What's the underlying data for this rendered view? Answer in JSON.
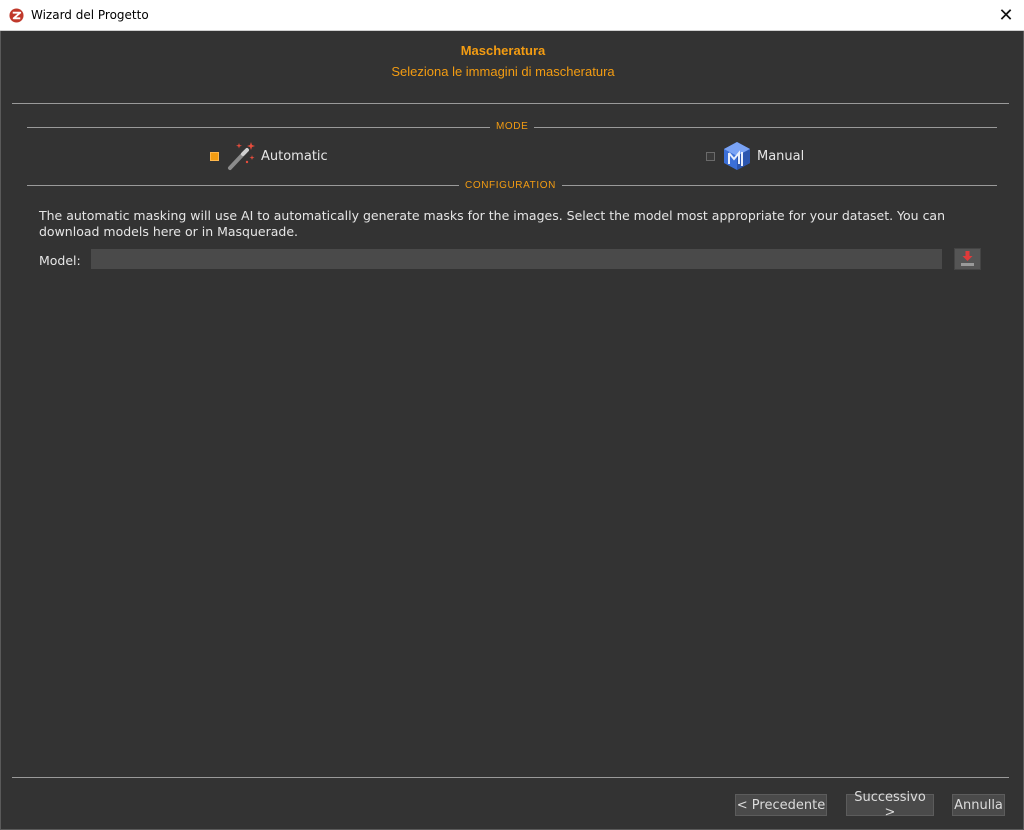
{
  "window": {
    "title": "Wizard del Progetto",
    "close_symbol": "✕"
  },
  "header": {
    "title": "Mascheratura",
    "subtitle": "Seleziona le immagini di mascheratura"
  },
  "mode": {
    "group_label": "MODE",
    "options": [
      {
        "label": "Automatic",
        "selected": true,
        "icon": "magic-wand-icon"
      },
      {
        "label": "Manual",
        "selected": false,
        "icon": "masquerade-cube-icon"
      }
    ]
  },
  "configuration": {
    "group_label": "CONFIGURATION",
    "description": "The automatic masking will use AI to automatically generate masks for the images. Select the model most appropriate for your dataset. You can download models here or in Masquerade.",
    "model_label": "Model:",
    "model_value": "",
    "download_icon": "download-icon"
  },
  "footer": {
    "prev_label": "< Precedente",
    "next_label": "Successivo >",
    "cancel_label": "Annulla"
  },
  "colors": {
    "accent": "#f39c12",
    "background": "#333333",
    "input_bg": "#4a4a4a",
    "download_red": "#e03a3a"
  }
}
